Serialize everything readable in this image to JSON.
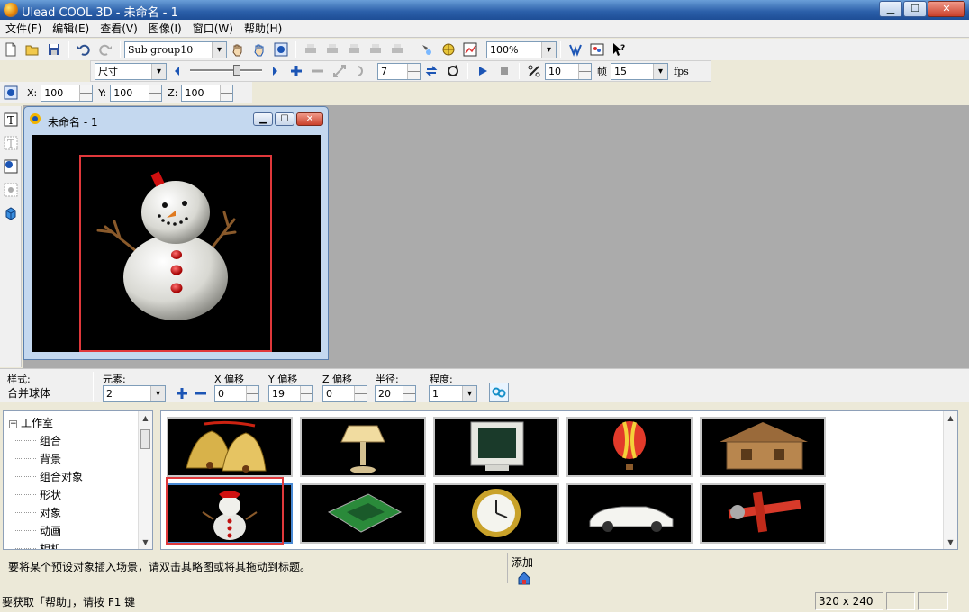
{
  "window": {
    "title": "Ulead COOL 3D - 未命名 - 1",
    "min": "▁",
    "max": "☐",
    "close": "✕"
  },
  "menus": [
    "文件(F)",
    "编辑(E)",
    "查看(V)",
    "图像(I)",
    "窗口(W)",
    "帮助(H)"
  ],
  "toolbar1": {
    "object_combo": "Sub group10",
    "zoom_combo": "100%"
  },
  "toolbar2": {
    "mode_combo": "尺寸",
    "frame_value": "7",
    "speed_value": "10",
    "frames_label": "帧",
    "fps_value": "15",
    "fps_label": "fps"
  },
  "toolbar3": {
    "x_label": "X:",
    "x_value": "100",
    "y_label": "Y:",
    "y_value": "100",
    "z_label": "Z:",
    "z_value": "100"
  },
  "document": {
    "title": "未命名 - 1"
  },
  "props": {
    "style_label": "样式:",
    "style_value": "合并球体",
    "elements_label": "元素:",
    "elements_value": "2",
    "x_offset_label": "X 偏移",
    "x_offset_value": "0",
    "y_offset_label": "Y 偏移",
    "y_offset_value": "19",
    "z_offset_label": "Z 偏移",
    "z_offset_value": "0",
    "radius_label": "半径:",
    "radius_value": "20",
    "degree_label": "程度:",
    "degree_value": "1"
  },
  "tree": {
    "root": "工作室",
    "items": [
      "组合",
      "背景",
      "组合对象",
      "形状",
      "对象",
      "动画",
      "相机"
    ]
  },
  "hint": "要将某个预设对象插入场景，请双击其略图或将其拖动到标题。",
  "add_label": "添加",
  "status": {
    "text": "要获取「帮助」，请按 F1 键",
    "size": "320 x 240"
  },
  "colors": {
    "title_bar": "#2a5ea8",
    "workspace": "#ababab",
    "highlight_box": "#e0383b",
    "canvas": "#000000"
  }
}
